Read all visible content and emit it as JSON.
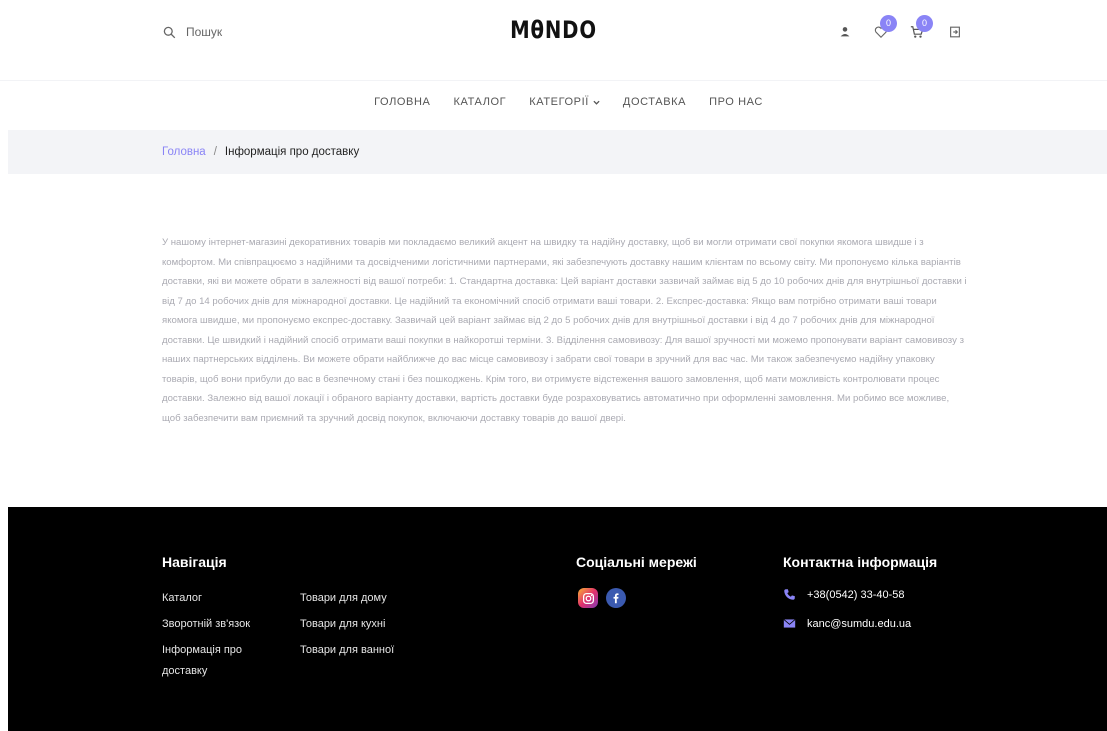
{
  "header": {
    "search_placeholder": "Пошук",
    "logo": "MθNDO",
    "wishlist_count": "0",
    "cart_count": "0"
  },
  "nav": {
    "items": [
      "Головна",
      "Каталог",
      "Категорії",
      "Доставка",
      "Про нас"
    ]
  },
  "breadcrumb": {
    "home": "Головна",
    "separator": "/",
    "current": "Інформація про доставку"
  },
  "content": {
    "text": "У нашому інтернет-магазині декоративних товарів ми покладаємо великий акцент на швидку та надійну доставку, щоб ви могли отримати свої покупки якомога швидше і з комфортом. Ми співпрацюємо з надійними та досвідченими логістичними партнерами, які забезпечують доставку нашим клієнтам по всьому світу. Ми пропонуємо кілька варіантів доставки, які ви можете обрати в залежності від вашої потреби: 1. Стандартна доставка: Цей варіант доставки зазвичай займає від 5 до 10 робочих днів для внутрішньої доставки і від 7 до 14 робочих днів для міжнародної доставки. Це надійний та економічний спосіб отримати ваші товари. 2. Експрес-доставка: Якщо вам потрібно отримати ваші товари якомога швидше, ми пропонуємо експрес-доставку. Зазвичай цей варіант займає від 2 до 5 робочих днів для внутрішньої доставки і від 4 до 7 робочих днів для міжнародної доставки. Це швидкий і надійний спосіб отримати ваші покупки в найкоротші терміни. 3. Відділення самовивозу: Для вашої зручності ми можемо пропонувати варіант самовивозу з наших партнерських відділень. Ви можете обрати найближче до вас місце самовивозу і забрати свої товари в зручний для вас час. Ми також забезпечуємо надійну упаковку товарів, щоб вони прибули до вас в безпечному стані і без пошкоджень. Крім того, ви отримуєте відстеження вашого замовлення, щоб мати можливість контролювати процес доставки. Залежно від вашої локації і обраного варіанту доставки, вартість доставки буде розраховуватись автоматично при оформленні замовлення. Ми робимо все можливе, щоб забезпечити вам приємний та зручний досвід покупок, включаючи доставку товарів до вашої двері."
  },
  "footer": {
    "nav_title": "Навігація",
    "nav_col1": [
      "Каталог",
      "Зворотній зв'язок",
      "Інформація про",
      "доставку"
    ],
    "nav_col2": [
      "Товари для дому",
      "Товари для кухні",
      "Товари для ванної"
    ],
    "social_title": "Соціальні мережі",
    "contact_title": "Контактна інформація",
    "phone": "+38(0542) 33-40-58",
    "email": "kanc@sumdu.edu.ua"
  },
  "colors": {
    "accent": "#8a84f6",
    "footer_bg": "#000000",
    "breadcrumb_bg": "#f3f4f7"
  }
}
